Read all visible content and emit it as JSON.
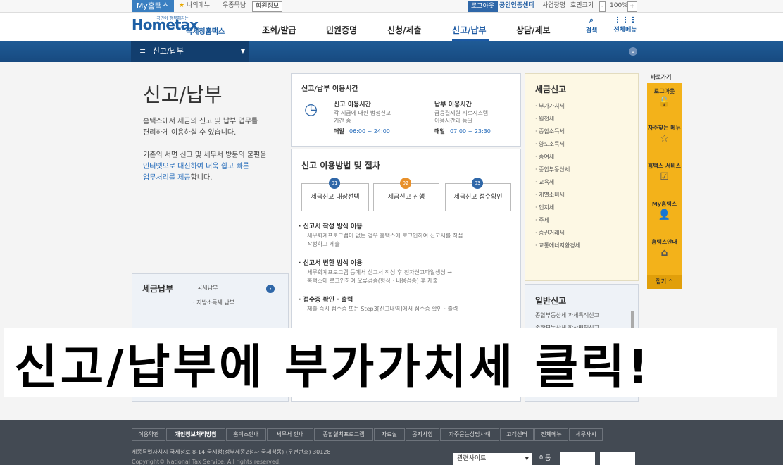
{
  "topbar": {
    "my_hometax": "My홈택스",
    "my_menu": "나의메뉴",
    "link_1": "우종목남",
    "member_info": "회원정보",
    "login": "로그아웃",
    "cert_center": "공인인증센터",
    "site_map": "사업장명",
    "lang": "호민크기",
    "zoom": "100%"
  },
  "header": {
    "logo_tiny": "국민이 행복해지는",
    "logo": "Hometax",
    "logo_sub": "국세청홈택스",
    "nav": [
      "조회/발급",
      "민원증명",
      "신청/제출",
      "신고/납부",
      "상담/제보"
    ],
    "active_nav": "신고/납부",
    "search": "검색",
    "all_menu": "전체메뉴"
  },
  "bluebar": {
    "crumb": "신고/납부"
  },
  "left": {
    "title": "신고/납부",
    "desc1": "홈택스에서 세금의 신고 및 납부 업무를",
    "desc2": "편리하게 이용하실 수 있습니다.",
    "desc3": "기존의 서면 신고 및 세무서 방문의 불편을",
    "desc4_link": "인터넷으로 대신하여 더욱 쉽고 빠른",
    "desc5_link": "업무처리를 제공",
    "desc5_tail": "합니다.",
    "pay_box": {
      "title": "세금납부",
      "item1": "국세납부",
      "item2": "· 지방소득세 납부"
    }
  },
  "hours": {
    "title": "신고/납부 이용시간",
    "report_title": "신고 이용시간",
    "report_desc1": "각 세금에 대한 법정신고",
    "report_desc2": "기간 중",
    "report_daily": "매일",
    "report_time": "06:00 ~ 24:00",
    "pay_title": "납부 이용시간",
    "pay_desc1": "금융결제원 지로시스템",
    "pay_desc2": "이용시간과 동일",
    "pay_daily": "매일",
    "pay_time": "07:00 ~ 23:30"
  },
  "procedure": {
    "title": "신고 이용방법 및 절차",
    "steps": [
      {
        "num": "01",
        "label": "세금신고 대상선택",
        "color": "#2f67a8"
      },
      {
        "num": "02",
        "label": "세금신고 진행",
        "color": "#e8902a"
      },
      {
        "num": "03",
        "label": "세금신고 접수확인",
        "color": "#2f67a8"
      }
    ],
    "items": [
      {
        "head": "· 신고서 작성 방식 이용",
        "d1": "세무회계프로그램이 없는 경우 홈택스에 로그인하여 신고서를 직접",
        "d2": "작성하고 제출"
      },
      {
        "head": "· 신고서 변환 방식 이용",
        "d1": "세무회계프로그램 등에서 신고서 작성 후 전자신고파일생성 →",
        "d2": "홈택스에 로그인하여 오류검증(형식 · 내용검증) 후 제출"
      },
      {
        "head": "· 접수증 확인 · 출력",
        "d1": "제출 즉시 접수증 또는 Step3[신고내역]에서 접수증 확인 · 출력",
        "d2": ""
      }
    ]
  },
  "tax_report": {
    "title": "세금신고",
    "items": [
      "부가가치세",
      "원천세",
      "종합소득세",
      "양도소득세",
      "증여세",
      "종합부동산세",
      "교육세",
      "개별소비세",
      "인지세",
      "주세",
      "증권거래세",
      "교통에너지환경세"
    ]
  },
  "general_report": {
    "title": "일반신고",
    "items": [
      "종합부동산세 과세특례신고",
      "종합부동산세 합산배제신고"
    ]
  },
  "quick": {
    "heading": "바로가기",
    "items": [
      {
        "label": "로그아웃",
        "icon": "lock-icon",
        "glyph": "🔓"
      },
      {
        "label": "자주찾는 메뉴",
        "icon": "star-icon",
        "glyph": "☆"
      },
      {
        "label": "홈택스 서비스",
        "icon": "checkbox-icon",
        "glyph": "☑"
      },
      {
        "label": "My홈택스",
        "icon": "person-icon",
        "glyph": "👤"
      },
      {
        "label": "홈택스안내",
        "icon": "home-icon",
        "glyph": "⌂"
      }
    ],
    "close": "접기 ^"
  },
  "footer": {
    "links": [
      "이용약관",
      "개인정보처리방침",
      "홈택스안내",
      "세무서 안내",
      "종합설치프로그램",
      "자료실",
      "공지사항",
      "자주묻는상담사례",
      "고객센터",
      "전체메뉴",
      "세무사시"
    ],
    "addr": "세종특별자치시 국세청로 8-14 국세청(정부세종2청사 국세청동) (우편번호) 30128",
    "copy": "Copyright© National Tax Service. All rights reserved.",
    "related": "관련사이트",
    "go": "이동"
  },
  "caption": "신고/납부에 부가가치세 클릭!"
}
